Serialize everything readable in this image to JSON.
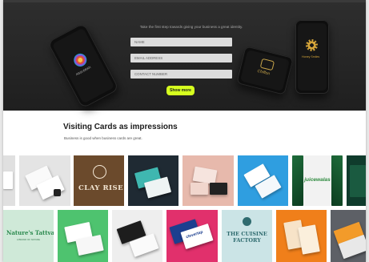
{
  "hero": {
    "tagline": "Take the first step towards giving your business a great identity.",
    "form": {
      "name_placeholder": "NAME",
      "email_placeholder": "EMAIL ADDRESS",
      "contact_placeholder": "CONTACT NUMBER"
    },
    "button_label": "Show more",
    "button_color": "#d6ff1f",
    "phones": [
      {
        "logo_icon": "flower-logo-icon",
        "logo_text": "AGGI ERATI"
      },
      {
        "logo_icon": "script-logo-icon",
        "logo_text": "Chiffon"
      },
      {
        "logo_icon": "gold-flower-logo-icon",
        "logo_text": "Honey Smiles"
      }
    ]
  },
  "section": {
    "title": "Visiting Cards as impressions",
    "subtitle": "Business is good when business cards are great."
  },
  "gallery": {
    "row1": [
      {
        "name": "partial-tile",
        "bg": "#e0e0e0"
      },
      {
        "name": "white-cards",
        "bg": "#e4e4e4"
      },
      {
        "name": "clay-rise",
        "bg": "#6b4a2c",
        "text": "CLAY RISE"
      },
      {
        "name": "teal-cards",
        "bg": "#1f2a33"
      },
      {
        "name": "pink-cards",
        "bg": "#e7b9ac"
      },
      {
        "name": "blue-cards",
        "bg": "#2f9ee0"
      },
      {
        "name": "juicewalas",
        "bg": "#f2f2f2",
        "text": "juicewalas"
      },
      {
        "name": "dark-green-tile",
        "bg": "#0f3b2c"
      }
    ],
    "row2": [
      {
        "name": "natures-tattva",
        "bg": "#cfe9d8",
        "text": "Nature's Tattva",
        "subtext": "A BRAND OF NATURE"
      },
      {
        "name": "green-white-cards",
        "bg": "#4ec36f"
      },
      {
        "name": "dark-cards",
        "bg": "#eeeeee"
      },
      {
        "name": "clevertap",
        "bg": "#e1306c",
        "text": "clevertap"
      },
      {
        "name": "cuisine-factory",
        "bg": "#cbe4e6",
        "text": "THE CUISINE FACTORY"
      },
      {
        "name": "orange-cards",
        "bg": "#f07f1a"
      },
      {
        "name": "grey-orange-cards",
        "bg": "#5d6066"
      }
    ]
  }
}
